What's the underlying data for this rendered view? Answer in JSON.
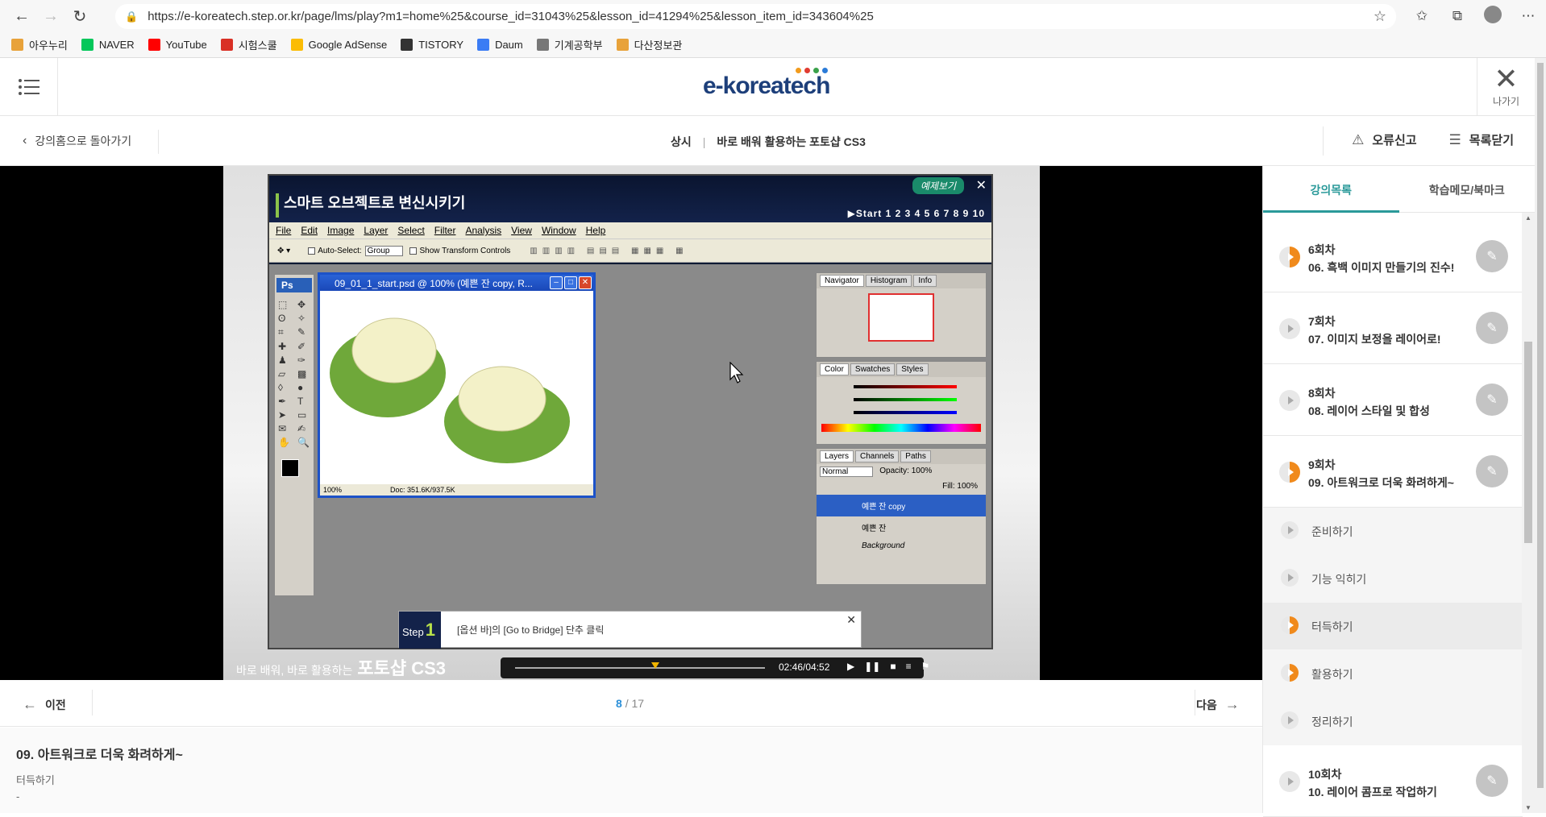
{
  "browser": {
    "url": "https://e-koreatech.step.or.kr/page/lms/play?m1=home%25&course_id=31043%25&lesson_id=41294%25&lesson_item_id=343604%25",
    "bookmarks": [
      {
        "label": "아우누리",
        "color": "#e8a23a"
      },
      {
        "label": "NAVER",
        "color": "#03c75a"
      },
      {
        "label": "YouTube",
        "color": "#ff0000"
      },
      {
        "label": "시험스쿨",
        "color": "#d93025"
      },
      {
        "label": "Google AdSense",
        "color": "#fbbc04"
      },
      {
        "label": "TISTORY",
        "color": "#333333"
      },
      {
        "label": "Daum",
        "color": "#3b7cf4"
      },
      {
        "label": "기계공학부",
        "color": "#777777"
      },
      {
        "label": "다산정보관",
        "color": "#e8a23a"
      }
    ]
  },
  "header": {
    "logo": "e-koreatech",
    "exit_label": "나가기",
    "back_label": "강의홈으로 돌아가기",
    "course_type": "상시",
    "course_name": "바로 배워 활용하는 포토샵 CS3",
    "report_label": "오류신고",
    "close_list_label": "목록닫기"
  },
  "video": {
    "ps_title": "스마트 오브젝트로 변신시키기",
    "example_label": "예제보기",
    "steps_label": "▶Start  1  2  3  4  5  6  7  8  9  10",
    "menus": [
      "File",
      "Edit",
      "Image",
      "Layer",
      "Select",
      "Filter",
      "Analysis",
      "View",
      "Window",
      "Help"
    ],
    "opt_autoselect": "Auto-Select:",
    "opt_group": "Group",
    "opt_transform": "Show Transform Controls",
    "doc_title": "09_01_1_start.psd @ 100% (예쁜 잔 copy, R...",
    "doc_zoom": "100%",
    "doc_size": "Doc: 351.6K/937.5K",
    "nav_tabs": [
      "Navigator",
      "Histogram",
      "Info"
    ],
    "color_tabs": [
      "Color",
      "Swatches",
      "Styles"
    ],
    "layer_tabs": [
      "Layers",
      "Channels",
      "Paths"
    ],
    "layer_mode": "Normal",
    "opacity": "Opacity: 100%",
    "fill": "Fill: 100%",
    "layers": [
      "예쁜 잔 copy",
      "예쁜 잔",
      "Background"
    ],
    "step_label": "Step",
    "step_num": "1",
    "step_text": "[옵션 바]의 [Go to Bridge] 단추 클릭",
    "footer_text": "바로 배워, 바로 활용하는",
    "footer_bold": "포토샵 CS3",
    "time": "02:46/04:52",
    "progress": 0.56
  },
  "pager": {
    "prev": "이전",
    "next": "다음",
    "current": "8",
    "total": "/ 17"
  },
  "lesson": {
    "title": "09. 아트워크로 더욱 화려하게~",
    "sub": "터득하기",
    "dash": "-"
  },
  "sidebar": {
    "tab_list": "강의목록",
    "tab_memo": "학습메모/북마크",
    "sessions": [
      {
        "num": "6회차",
        "name": "06. 흑백 이미지 만들기의 진수!",
        "status": "half"
      },
      {
        "num": "7회차",
        "name": "07. 이미지 보정을 레이어로!",
        "status": "none"
      },
      {
        "num": "8회차",
        "name": "08. 레이어 스타일 및 합성",
        "status": "none"
      },
      {
        "num": "9회차",
        "name": "09. 아트워크로 더욱 화려하게~",
        "status": "half"
      }
    ],
    "sub_items": [
      {
        "label": "준비하기",
        "status": "none"
      },
      {
        "label": "기능 익히기",
        "status": "none"
      },
      {
        "label": "터득하기",
        "status": "half",
        "active": true
      },
      {
        "label": "활용하기",
        "status": "half"
      },
      {
        "label": "정리하기",
        "status": "none"
      }
    ],
    "last_session": {
      "num": "10회차",
      "name": "10. 레이어 콤프로 작업하기",
      "status": "none"
    }
  }
}
